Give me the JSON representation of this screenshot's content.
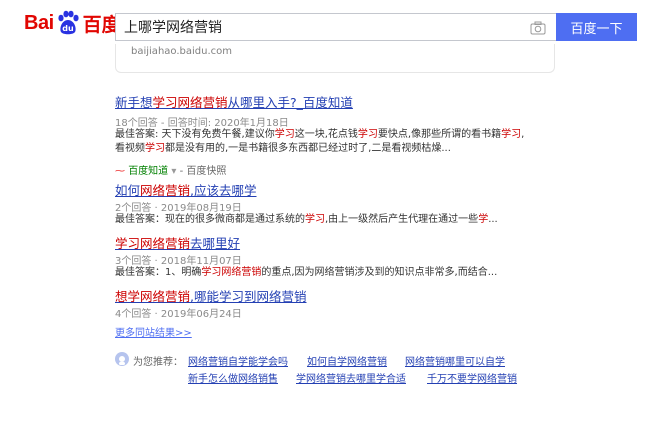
{
  "header": {
    "logo_bai": "Bai",
    "logo_du": "百度",
    "query": "上哪学网络营销",
    "search_button": "百度一下"
  },
  "top_card": {
    "url": "baijiahao.baidu.com"
  },
  "result": {
    "title_pre": "新手想",
    "title_em": "学习网络营销",
    "title_post": "从哪里入手?_百度知道",
    "meta": "18个回答 - 回答时间: 2020年1月18日",
    "snippet_1a": "最佳答案: 天下没有免费午餐,建议你",
    "snippet_1em": "学习",
    "snippet_1b": "这一块,花点钱",
    "snippet_1em2": "学习",
    "snippet_1c": "要快点,像那些所谓的看书籍",
    "snippet_1em3": "学习",
    "snippet_1d": ",",
    "snippet_2a": "看视频",
    "snippet_2em": "学习",
    "snippet_2b": "都是没有用的,一是书籍很多东西都已经过时了,二是看视频枯燥...",
    "source": "百度知道",
    "source_suffix": "- 百度快照",
    "sub": [
      {
        "title_pre": "如何",
        "title_em": "网络营销",
        "title_post": ",应该去哪学",
        "meta": "2个回答 · 2019年08月19日",
        "snippet_a": "最佳答案：现在的很多微商都是通过系统的",
        "snippet_em": "学习",
        "snippet_b": ",由上一级然后产生代理在通过一些",
        "snippet_em2": "学",
        "snippet_c": "..."
      },
      {
        "title_pre": "",
        "title_em": "学习网络营销",
        "title_post": "去哪里好",
        "meta": "3个回答 · 2018年11月07日",
        "snippet_a": "最佳答案：1、明确",
        "snippet_em": "学习网络营销",
        "snippet_b": "的重点,因为网络营销涉及到的知识点非常多,而结合...",
        "snippet_em2": "",
        "snippet_c": ""
      },
      {
        "title_pre": "",
        "title_em": "想学网络营销",
        "title_post": ",哪能学习到网络营销",
        "meta": "4个回答 · 2019年06月24日"
      }
    ],
    "more": "更多同站结果>>"
  },
  "recommend": {
    "label": "为您推荐：",
    "links": [
      "网络营销自学能学会吗",
      "如何自学网络营销",
      "网络营销哪里可以自学",
      "新手怎么做网络销售",
      "学网络营销去哪里学合适",
      "千万不要学网络营销"
    ]
  },
  "colors": {
    "brand_red": "#e10602",
    "brand_blue": "#2932e1",
    "button": "#4e6ef2",
    "link": "#2440b3",
    "highlight": "#cc0000"
  }
}
